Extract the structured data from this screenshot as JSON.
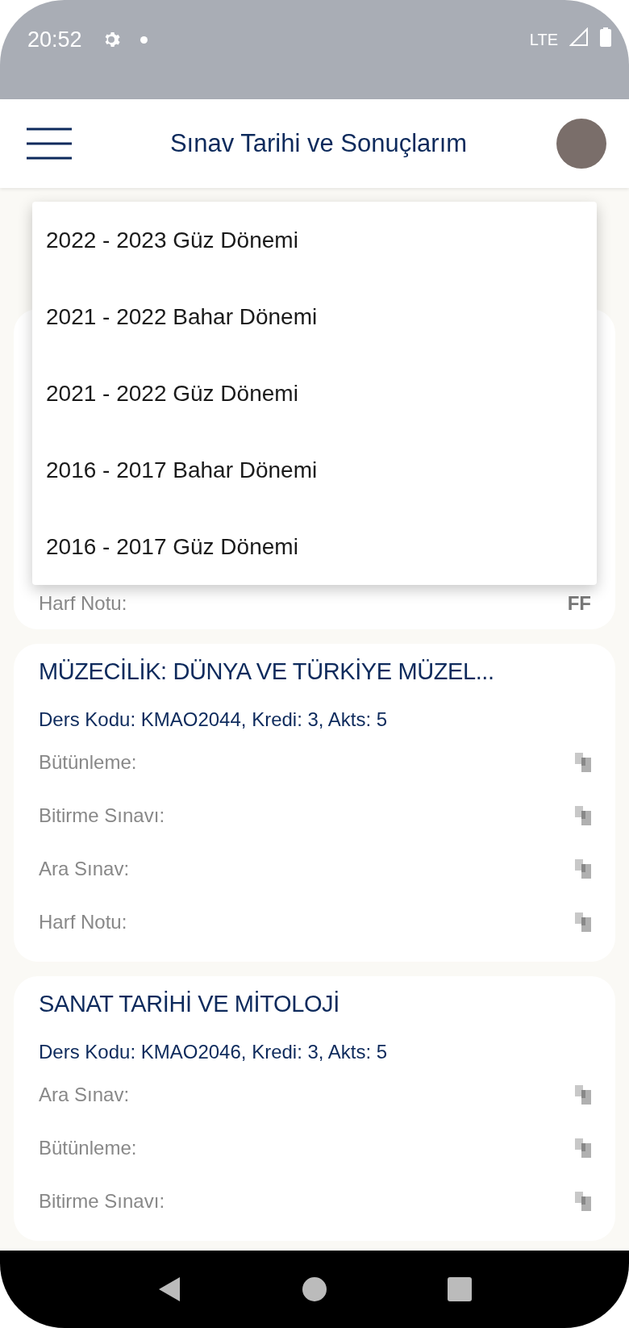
{
  "status_bar": {
    "time": "20:52",
    "network": "LTE"
  },
  "header": {
    "title": "Sınav Tarihi ve Sonuçlarım"
  },
  "term_menu": {
    "items": [
      {
        "label": "2022 - 2023 Güz Dönemi"
      },
      {
        "label": "2021 - 2022 Bahar Dönemi"
      },
      {
        "label": "2021 - 2022 Güz Dönemi"
      },
      {
        "label": "2016 - 2017 Bahar Dönemi"
      },
      {
        "label": "2016 - 2017 Güz Dönemi"
      }
    ]
  },
  "courses": [
    {
      "rows": [
        {
          "label": "Harf Notu:",
          "value": "FF"
        }
      ]
    },
    {
      "title": "MÜZECİLİK: DÜNYA VE TÜRKİYE MÜZEL...",
      "info": "Ders Kodu: KMAO2044, Kredi: 3, Akts: 5",
      "rows": [
        {
          "label": "Bütünleme:",
          "pixelated": true
        },
        {
          "label": "Bitirme Sınavı:",
          "pixelated": true
        },
        {
          "label": "Ara Sınav:",
          "pixelated": true
        },
        {
          "label": "Harf Notu:",
          "pixelated": true
        }
      ]
    },
    {
      "title": "SANAT TARİHİ VE MİTOLOJİ",
      "info": "Ders Kodu: KMAO2046, Kredi: 3, Akts: 5",
      "rows": [
        {
          "label": "Ara Sınav:",
          "pixelated": true
        },
        {
          "label": "Bütünleme:",
          "pixelated": true
        },
        {
          "label": "Bitirme Sınavı:",
          "pixelated": true
        }
      ]
    }
  ]
}
